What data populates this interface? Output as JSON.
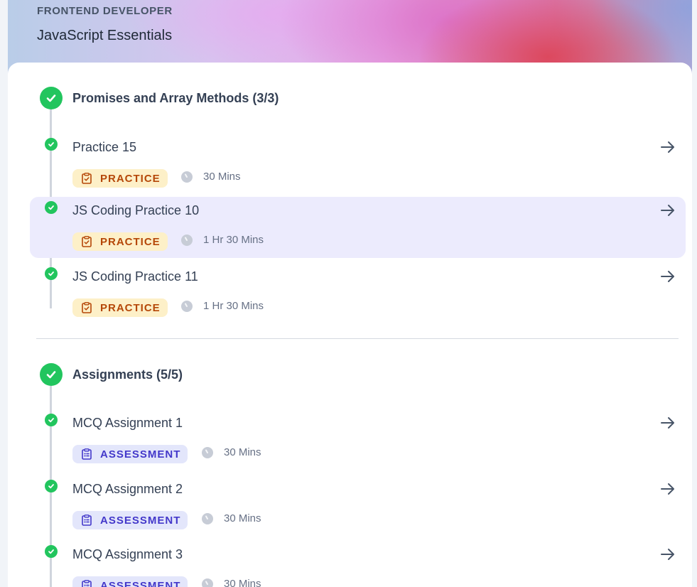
{
  "header": {
    "kicker": "FRONTEND DEVELOPER",
    "title": "JavaScript Essentials"
  },
  "sections": [
    {
      "title": "Promises and Array Methods (3/3)",
      "items": [
        {
          "title": "Practice 15",
          "type": "PRACTICE",
          "duration": "30 Mins",
          "completed": true,
          "active": false
        },
        {
          "title": "JS Coding Practice 10",
          "type": "PRACTICE",
          "duration": "1 Hr 30 Mins",
          "completed": true,
          "active": true
        },
        {
          "title": "JS Coding Practice 11",
          "type": "PRACTICE",
          "duration": "1 Hr 30 Mins",
          "completed": true,
          "active": false
        }
      ]
    },
    {
      "title": "Assignments (5/5)",
      "items": [
        {
          "title": "MCQ Assignment 1",
          "type": "ASSESSMENT",
          "duration": "30 Mins",
          "completed": true,
          "active": false
        },
        {
          "title": "MCQ Assignment 2",
          "type": "ASSESSMENT",
          "duration": "30 Mins",
          "completed": true,
          "active": false
        },
        {
          "title": "MCQ Assignment 3",
          "type": "ASSESSMENT",
          "duration": "30 Mins",
          "completed": true,
          "active": false
        }
      ]
    }
  ],
  "colors": {
    "success": "#22c55e",
    "practice_bg": "#fdf0c8",
    "practice_text": "#b54708",
    "assessment_bg": "#e3e6fb",
    "assessment_text": "#4338ca",
    "active_row": "#ecebfd"
  },
  "icons": {
    "section_status": "check-circle-icon",
    "item_status": "check-circle-icon",
    "badge": "clipboard-icon",
    "duration": "clock-icon",
    "open": "arrow-right-icon"
  }
}
